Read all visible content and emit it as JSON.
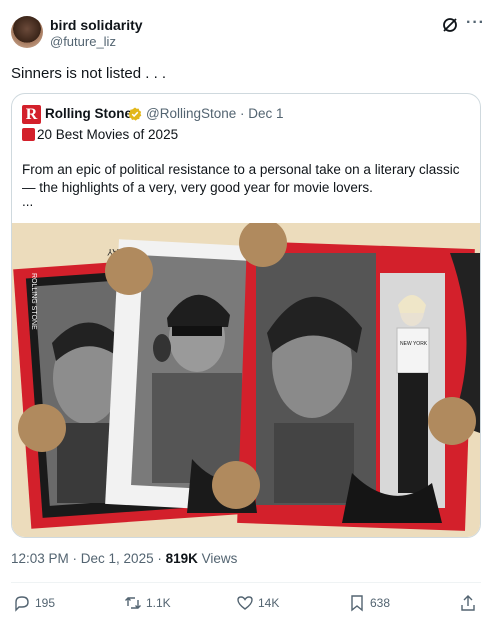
{
  "author": {
    "name": "bird solidarity",
    "handle": "@future_liz",
    "avatar_icon": "avatar"
  },
  "tweet": {
    "text": "Sinners is not listed . . ."
  },
  "quote": {
    "name": "Rolling Stone",
    "logo_letter": "R",
    "handle_date": "@RollingStone · Dec 1",
    "title": "20 Best Movies of 2025",
    "body": "From an epic of political resistance to a personal take on a literary classic — the highlights of a very, very good year for movie lovers.",
    "ellipsis": "...",
    "poster": {
      "stamp_top": "MAY",
      "side_text": "ROLLING STONE",
      "shirt_text": "NEW YORK",
      "colors": {
        "red": "#d3202b",
        "cream": "#ecdcbc",
        "tan": "#b08a5e"
      }
    }
  },
  "meta": {
    "time": "12:03 PM · Dec 1, 2025 · ",
    "views_count": "819K",
    "views_label": " Views"
  },
  "actions": {
    "replies": "195",
    "retweets": "1.1K",
    "likes": "14K",
    "bookmarks": "638"
  },
  "colors": {
    "text": "#0f1419",
    "secondary": "#536471",
    "verified": "#e2b719",
    "border": "#cfd9de"
  }
}
